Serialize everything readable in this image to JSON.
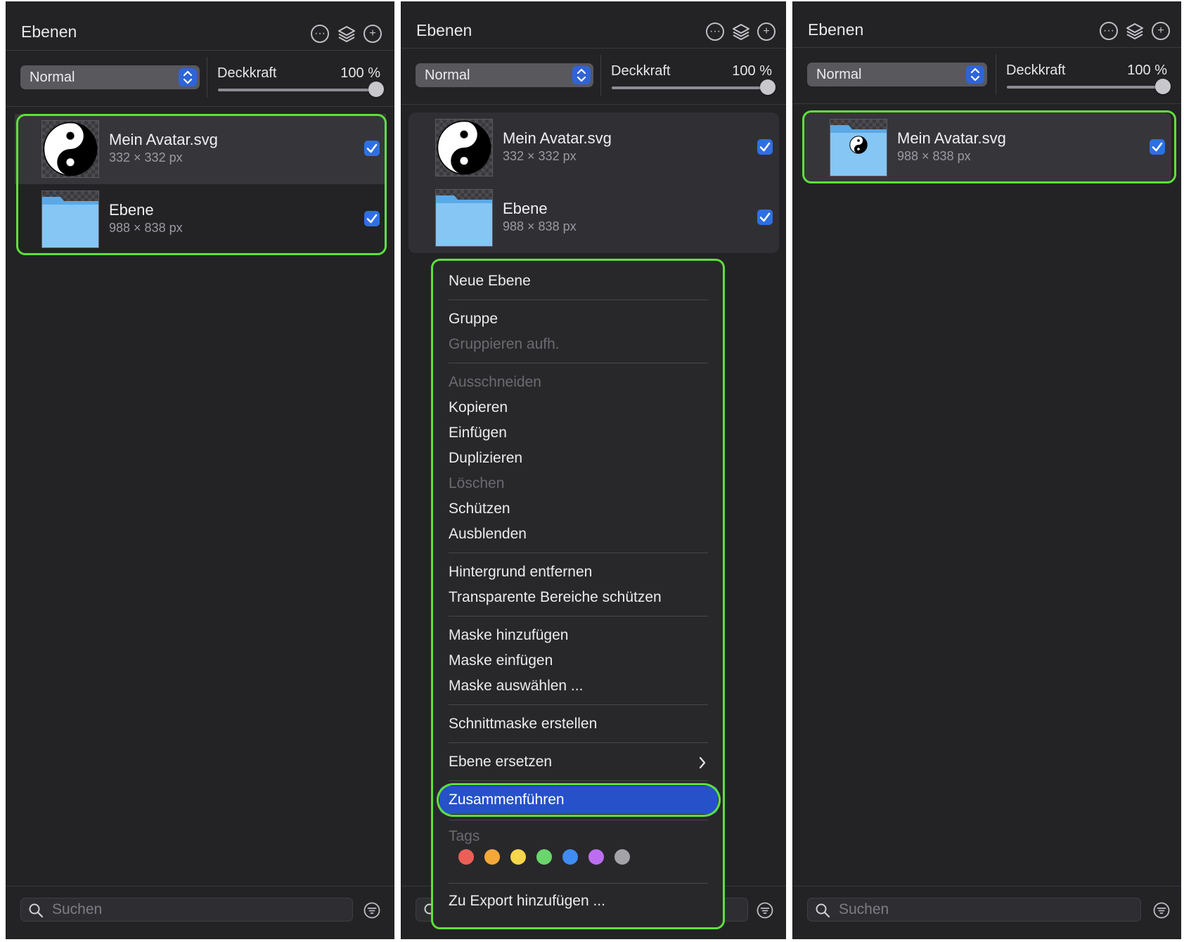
{
  "panel_title": "Ebenen",
  "blend_mode": "Normal",
  "opacity": {
    "label": "Deckkraft",
    "value": "100 %",
    "level": 1.0
  },
  "search_placeholder": "Suchen",
  "panel1": {
    "layers": [
      {
        "name": "Mein Avatar.svg",
        "size": "332 × 332 px",
        "visible": true
      },
      {
        "name": "Ebene",
        "size": "988 × 838 px",
        "visible": true
      }
    ]
  },
  "panel2": {
    "layers": [
      {
        "name": "Mein Avatar.svg",
        "size": "332 × 332 px",
        "visible": true
      },
      {
        "name": "Ebene",
        "size": "988 × 838 px",
        "visible": true
      }
    ],
    "context_menu": {
      "new_layer": "Neue Ebene",
      "group": "Gruppe",
      "ungroup": "Gruppieren aufh.",
      "cut": "Ausschneiden",
      "copy": "Kopieren",
      "paste": "Einfügen",
      "duplicate": "Duplizieren",
      "delete": "Löschen",
      "protect": "Schützen",
      "hide": "Ausblenden",
      "remove_background": "Hintergrund entfernen",
      "protect_transparent": "Transparente Bereiche schützen",
      "add_mask": "Maske hinzufügen",
      "paste_mask": "Maske einfügen",
      "select_mask": "Maske auswählen ...",
      "clipping_mask": "Schnittmaske erstellen",
      "replace_layer": "Ebene ersetzen",
      "merge": "Zusammenführen",
      "tags_label": "Tags",
      "tag_colors": [
        "#ec5f57",
        "#f4a83a",
        "#f7d64a",
        "#69d66c",
        "#3f8cf3",
        "#bd6ef0",
        "#a3a3a8"
      ],
      "add_to_export": "Zu Export hinzufügen ..."
    }
  },
  "panel3": {
    "layers": [
      {
        "name": "Mein Avatar.svg",
        "size": "988 × 838 px",
        "visible": true
      }
    ]
  },
  "colors": {
    "panel_bg": "#232326",
    "accent_blue": "#2f6fe4",
    "highlight_green": "#5ee03a",
    "menu_active": "#2651c8"
  }
}
